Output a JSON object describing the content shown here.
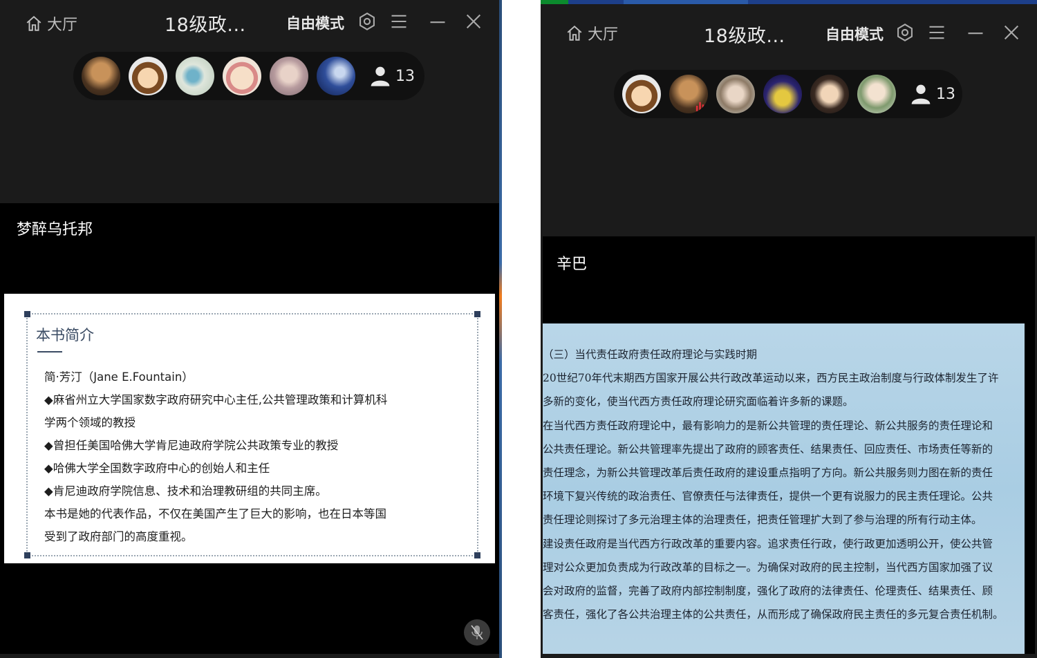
{
  "left_window": {
    "home_label": "大厅",
    "room_title": "18级政...",
    "mode_label": "自由模式",
    "member_count": "13",
    "speaker_name": "梦醉乌托邦",
    "slide": {
      "heading": "本书简介",
      "lines": [
        "简·芳汀（Jane E.Fountain）",
        "◆麻省州立大学国家数字政府研究中心主任,公共管理政策和计算机科",
        "学两个领域的教授",
        "◆曾担任美国哈佛大学肯尼迪政府学院公共政策专业的教授",
        "◆哈佛大学全国数字政府中心的创始人和主任",
        "◆肯尼迪政府学院信息、技术和治理教研组的共同主席。",
        "本书是她的代表作品，不仅在美国产生了巨大的影响，也在日本等国",
        "受到了政府部门的高度重视。"
      ]
    }
  },
  "right_window": {
    "home_label": "大厅",
    "room_title": "18级政...",
    "mode_label": "自由模式",
    "member_count": "13",
    "speaker_name": "辛巴",
    "document": {
      "lines": [
        "（三）当代责任政府责任政府理论与实践时期",
        "20世纪70年代末期西方国家开展公共行政改革运动以来，西方民主政治制度与行政体制发生了许",
        "多新的变化，使当代西方责任政府理论研究面临着许多新的课题。",
        "在当代西方责任政府理论中，最有影响力的是新公共管理的责任理论、新公共服务的责任理论和",
        "公共责任理论。新公共管理率先提出了政府的顾客责任、结果责任、回应责任、市场责任等新的",
        "责任理念，为新公共管理改革后责任政府的建设重点指明了方向。新公共服务则力图在新的责任",
        "环境下复兴传统的政治责任、官僚责任与法律责任，提供一个更有说服力的民主责任理论。公共",
        "责任理论则探讨了多元治理主体的治理责任，把责任管理扩大到了参与治理的所有行动主体。",
        "建设责任政府是当代西方行政改革的重要内容。追求责任行政，使行政更加透明公开，使公共管",
        "理对公众更加负责成为行政改革的目标之一。为确保对政府的民主控制，当代西方国家加强了议",
        "会对政府的监督，完善了政府内部控制制度，强化了政府的法律责任、伦理责任、结果责任、顾",
        "客责任，强化了各公共治理主体的公共责任，从而形成了确保政府民主责任的多元复合责任机制。"
      ]
    }
  },
  "colors": {
    "window_bg": "#1b1b1b",
    "video_bg": "#000000",
    "doc_bg": "#b9d6e8"
  }
}
